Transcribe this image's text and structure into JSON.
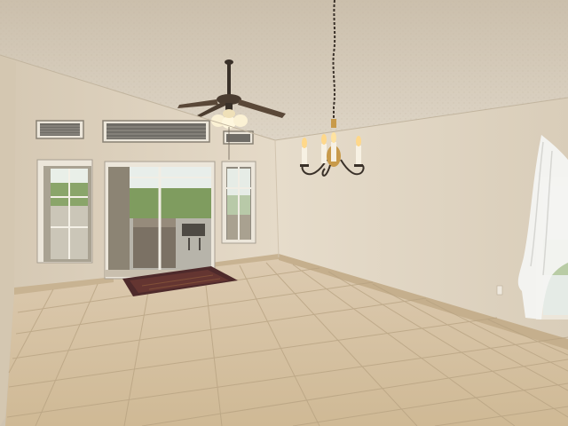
{
  "scene": {
    "subject": "empty-room-interior",
    "colors": {
      "ceiling": "#d8cfbf",
      "ceiling_shadow": "#c7bba7",
      "wall_left": "#e4d9c8",
      "wall_back": "#e8ddcc",
      "wall_right": "#e2d6c3",
      "floor": "#d6c3a2",
      "floor_grout": "#b9a584",
      "baseboard": "#c9b594",
      "window_frame": "#ece6da",
      "glass_sky": "#e9f0ee",
      "glass_grass": "#7d9a5d",
      "rug": "#5a2f2d",
      "curtain": "#f4f4f2",
      "metal": "#3a3129",
      "brass": "#c89a4a",
      "candle": "#f7f1e3",
      "flame": "#ffd88a",
      "lamp_glass": "#fbf1d4"
    }
  }
}
